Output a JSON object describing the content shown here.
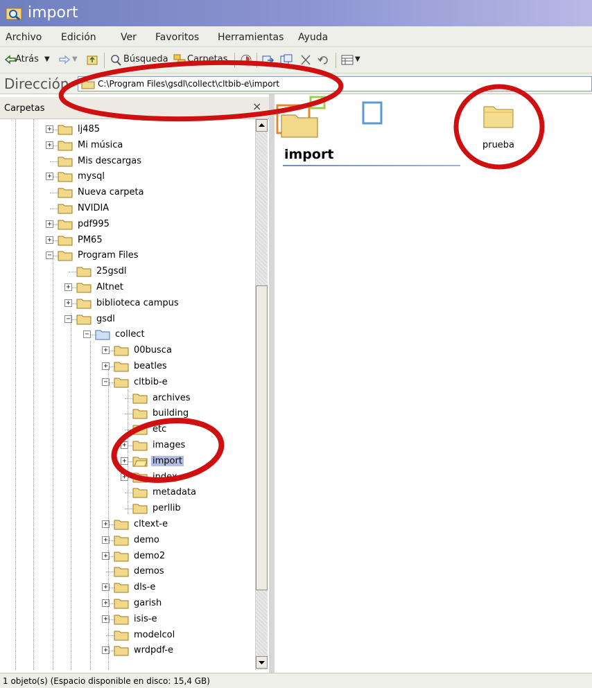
{
  "window": {
    "title": "import"
  },
  "menu": {
    "items": [
      "Archivo",
      "Edición",
      "Ver",
      "Favoritos",
      "Herramientas",
      "Ayuda"
    ]
  },
  "toolbar": {
    "back": "Atrás",
    "search": "Búsqueda",
    "folders": "Carpetas"
  },
  "address": {
    "label": "Dirección",
    "value": "C:\\Program Files\\gsdl\\collect\\cltbib-e\\import"
  },
  "folders_pane": {
    "title": "Carpetas",
    "close": "×",
    "items": [
      {
        "label": "lj485",
        "level": 0,
        "expander": "+"
      },
      {
        "label": "Mi música",
        "level": 0,
        "expander": "+"
      },
      {
        "label": "Mis descargas",
        "level": 0,
        "expander": ""
      },
      {
        "label": "mysql",
        "level": 0,
        "expander": "+"
      },
      {
        "label": "Nueva carpeta",
        "level": 0,
        "expander": ""
      },
      {
        "label": "NVIDIA",
        "level": 0,
        "expander": ""
      },
      {
        "label": "pdf995",
        "level": 0,
        "expander": "+"
      },
      {
        "label": "PM65",
        "level": 0,
        "expander": "+"
      },
      {
        "label": "Program Files",
        "level": 0,
        "expander": "−"
      },
      {
        "label": "25gsdl",
        "level": 1,
        "expander": ""
      },
      {
        "label": "Altnet",
        "level": 1,
        "expander": "+"
      },
      {
        "label": "biblioteca campus",
        "level": 1,
        "expander": "+"
      },
      {
        "label": "gsdl",
        "level": 1,
        "expander": "−"
      },
      {
        "label": "collect",
        "level": 2,
        "expander": "−"
      },
      {
        "label": "00busca",
        "level": 3,
        "expander": "+"
      },
      {
        "label": "beatles",
        "level": 3,
        "expander": "+"
      },
      {
        "label": "cltbib-e",
        "level": 3,
        "expander": "−"
      },
      {
        "label": "archives",
        "level": 4,
        "expander": ""
      },
      {
        "label": "building",
        "level": 4,
        "expander": ""
      },
      {
        "label": "etc",
        "level": 4,
        "expander": ""
      },
      {
        "label": "images",
        "level": 4,
        "expander": "+"
      },
      {
        "label": "import",
        "level": 4,
        "expander": "+",
        "selected": true
      },
      {
        "label": "index",
        "level": 4,
        "expander": "+"
      },
      {
        "label": "metadata",
        "level": 4,
        "expander": ""
      },
      {
        "label": "perllib",
        "level": 4,
        "expander": ""
      },
      {
        "label": "cltext-e",
        "level": 3,
        "expander": "+"
      },
      {
        "label": "demo",
        "level": 3,
        "expander": "+"
      },
      {
        "label": "demo2",
        "level": 3,
        "expander": "+"
      },
      {
        "label": "demos",
        "level": 3,
        "expander": ""
      },
      {
        "label": "dls-e",
        "level": 3,
        "expander": "+"
      },
      {
        "label": "garish",
        "level": 3,
        "expander": "+"
      },
      {
        "label": "isis-e",
        "level": 3,
        "expander": "+"
      },
      {
        "label": "modelcol",
        "level": 3,
        "expander": ""
      },
      {
        "label": "wrdpdf-e",
        "level": 3,
        "expander": "+"
      }
    ]
  },
  "content": {
    "heading": "import",
    "items": [
      {
        "label": "prueba"
      }
    ]
  },
  "status": {
    "text": "1 objeto(s) (Espacio disponible en disco:  15,4 GB)"
  },
  "colors": {
    "annotation": "#d01010",
    "selection": "#b3bde2",
    "folder": "#f2d98a"
  }
}
